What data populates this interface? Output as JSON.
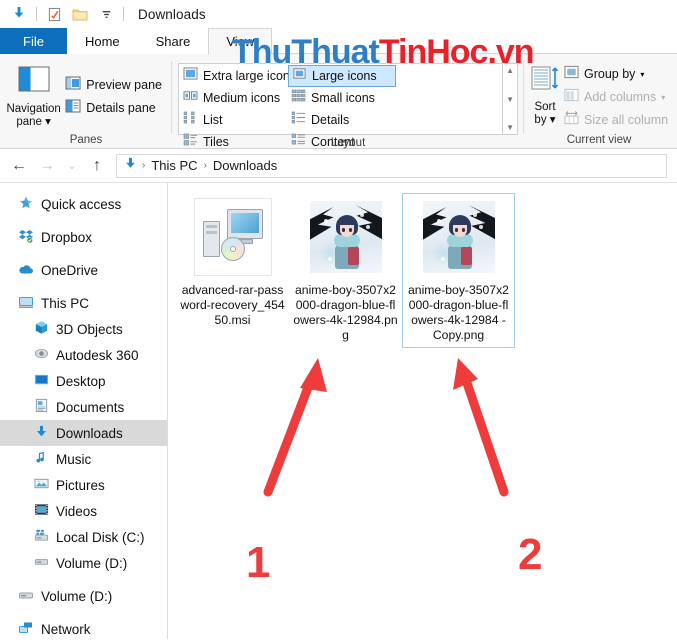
{
  "window": {
    "title": "Downloads",
    "quick_access": [
      {
        "name": "downloads-icon",
        "label": "Downloads"
      },
      {
        "name": "properties-icon",
        "label": "Properties"
      },
      {
        "name": "new-folder-icon",
        "label": "New folder"
      },
      {
        "name": "chevron-down-icon",
        "label": "Customize Quick Access Toolbar"
      }
    ]
  },
  "tabs": [
    {
      "label": "File",
      "id": "file"
    },
    {
      "label": "Home",
      "id": "home"
    },
    {
      "label": "Share",
      "id": "share"
    },
    {
      "label": "View",
      "id": "view"
    }
  ],
  "active_tab": "View",
  "ribbon": {
    "panes": {
      "title": "Panes",
      "navigation_pane": "Navigation\npane",
      "navigation_pane_label": "Navigation",
      "navigation_pane_label2": "pane",
      "preview_pane": "Preview pane",
      "details_pane": "Details pane"
    },
    "layout": {
      "title": "Layout",
      "options": [
        {
          "label": "Extra large icons",
          "selected": false
        },
        {
          "label": "Large icons",
          "selected": true
        },
        {
          "label": "Medium icons",
          "selected": false
        },
        {
          "label": "Small icons",
          "selected": false
        },
        {
          "label": "List",
          "selected": false
        },
        {
          "label": "Details",
          "selected": false
        },
        {
          "label": "Tiles",
          "selected": false
        },
        {
          "label": "Content",
          "selected": false
        }
      ]
    },
    "current_view": {
      "title": "Current view",
      "sort_by_line1": "Sort",
      "sort_by_line2": "by",
      "group_by": "Group by",
      "add_columns": "Add columns",
      "size_all_columns": "Size all column"
    }
  },
  "address_bar": {
    "back": "Back",
    "forward": "Forward",
    "recent": "Recent locations",
    "up": "Up",
    "breadcrumbs": [
      "This PC",
      "Downloads"
    ],
    "separator": "›"
  },
  "sidebar": {
    "items": [
      {
        "label": "Quick access",
        "icon": "star-pin-icon",
        "level": 0,
        "selected": false,
        "spacer_after": true
      },
      {
        "label": "Dropbox",
        "icon": "dropbox-icon",
        "level": 0,
        "selected": false,
        "spacer_after": true
      },
      {
        "label": "OneDrive",
        "icon": "cloud-icon",
        "level": 0,
        "selected": false,
        "spacer_after": true
      },
      {
        "label": "This PC",
        "icon": "monitor-icon",
        "level": 0,
        "selected": false,
        "spacer_after": false
      },
      {
        "label": "3D Objects",
        "icon": "cube-icon",
        "level": 1,
        "selected": false,
        "spacer_after": false
      },
      {
        "label": "Autodesk 360",
        "icon": "autodesk-icon",
        "level": 1,
        "selected": false,
        "spacer_after": false
      },
      {
        "label": "Desktop",
        "icon": "desktop-icon",
        "level": 1,
        "selected": false,
        "spacer_after": false
      },
      {
        "label": "Documents",
        "icon": "document-icon",
        "level": 1,
        "selected": false,
        "spacer_after": false
      },
      {
        "label": "Downloads",
        "icon": "downloads-icon",
        "level": 1,
        "selected": true,
        "spacer_after": false
      },
      {
        "label": "Music",
        "icon": "music-note-icon",
        "level": 1,
        "selected": false,
        "spacer_after": false
      },
      {
        "label": "Pictures",
        "icon": "picture-icon",
        "level": 1,
        "selected": false,
        "spacer_after": false
      },
      {
        "label": "Videos",
        "icon": "video-icon",
        "level": 1,
        "selected": false,
        "spacer_after": false
      },
      {
        "label": "Local Disk (C:)",
        "icon": "disk-icon",
        "level": 1,
        "selected": false,
        "spacer_after": false
      },
      {
        "label": "Volume (D:)",
        "icon": "drive-icon",
        "level": 1,
        "selected": false,
        "spacer_after": true
      },
      {
        "label": "Volume (D:)",
        "icon": "drive-icon",
        "level": 0,
        "selected": false,
        "spacer_after": true
      },
      {
        "label": "Network",
        "icon": "network-icon",
        "level": 0,
        "selected": false,
        "spacer_after": false
      }
    ]
  },
  "files": [
    {
      "name": "advanced-rar-password-recovery_45450.msi",
      "display_name": "advanced-rar-password-recovery_45450.msi",
      "type": "msi",
      "selected": false
    },
    {
      "name": "anime-boy-3507x2000-dragon-blue-flowers-4k-12984.png",
      "display_name": "anime-boy-3507x2000-dragon-blue-flowers-4k-12984.png",
      "type": "png",
      "selected": false
    },
    {
      "name": "anime-boy-3507x2000-dragon-blue-flowers-4k-12984 - Copy.png",
      "display_name": "anime-boy-3507x2000-dragon-blue-flowers-4k-12984 - Copy.png",
      "type": "png",
      "selected": true
    }
  ],
  "watermark": {
    "part_blue": "ThuThuat",
    "part_red": "TinHoc.vn",
    "color_blue": "#2E7FC4",
    "color_red": "#E8222B"
  },
  "annotations": {
    "color": "#EE3B3B",
    "markers": [
      {
        "number": "1",
        "points_to": "anime-boy-3507x2000-dragon-blue-flowers-4k-12984.png"
      },
      {
        "number": "2",
        "points_to": "anime-boy-3507x2000-dragon-blue-flowers-4k-12984 - Copy.png"
      }
    ]
  }
}
